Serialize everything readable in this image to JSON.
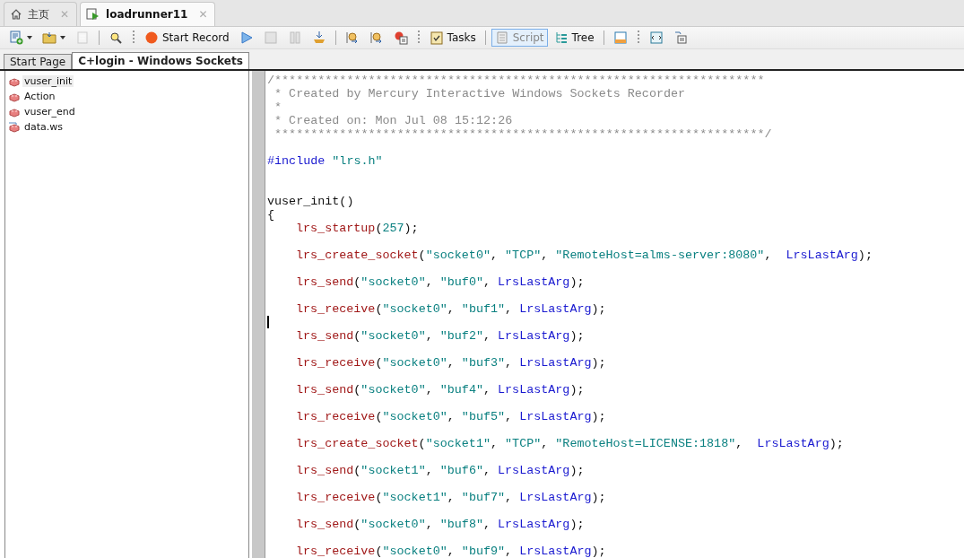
{
  "doc_tabs": [
    {
      "label": "主页",
      "close": "✕",
      "selected": false
    },
    {
      "label": "loadrunner11",
      "close": "✕",
      "selected": true
    }
  ],
  "toolbar": [
    {
      "kind": "new",
      "dropdown": true
    },
    {
      "kind": "open",
      "dropdown": true
    },
    {
      "kind": "save",
      "disabled": true
    },
    {
      "kind": "sep"
    },
    {
      "kind": "find"
    },
    {
      "kind": "grip"
    },
    {
      "kind": "record",
      "label": "Start Record"
    },
    {
      "kind": "play"
    },
    {
      "kind": "stop",
      "disabled": true
    },
    {
      "kind": "pause",
      "disabled": true
    },
    {
      "kind": "compile"
    },
    {
      "kind": "sep"
    },
    {
      "kind": "stepin"
    },
    {
      "kind": "stepout"
    },
    {
      "kind": "breakpoint"
    },
    {
      "kind": "grip"
    },
    {
      "kind": "tasks",
      "label": "Tasks"
    },
    {
      "kind": "sep"
    },
    {
      "kind": "script",
      "label": "Script",
      "selected": true
    },
    {
      "kind": "tree",
      "label": "Tree",
      "selected": false
    },
    {
      "kind": "sep"
    },
    {
      "kind": "layout"
    },
    {
      "kind": "grip"
    },
    {
      "kind": "params"
    },
    {
      "kind": "list"
    }
  ],
  "editor_tabs": [
    {
      "label": "Start Page",
      "selected": false
    },
    {
      "label": "C+login - Windows Sockets",
      "selected": true
    }
  ],
  "tree": [
    {
      "label": "vuser_init",
      "kind": "action",
      "selected": true
    },
    {
      "label": "Action",
      "kind": "action",
      "selected": false
    },
    {
      "label": "vuser_end",
      "kind": "action",
      "selected": false
    },
    {
      "label": "data.ws",
      "kind": "data",
      "selected": false
    }
  ],
  "code": [
    {
      "kind": "text",
      "parts": [
        {
          "kind": "comment",
          "text": "/********************************************************************"
        }
      ]
    },
    {
      "kind": "text",
      "parts": [
        {
          "kind": "comment",
          "text": " * Created by Mercury Interactive Windows Sockets Recorder"
        }
      ]
    },
    {
      "kind": "text",
      "parts": [
        {
          "kind": "comment",
          "text": " *"
        }
      ]
    },
    {
      "kind": "text",
      "parts": [
        {
          "kind": "comment",
          "text": " * Created on: Mon Jul 08 15:12:26"
        }
      ]
    },
    {
      "kind": "text",
      "parts": [
        {
          "kind": "comment",
          "text": " ********************************************************************/"
        }
      ]
    },
    {
      "kind": "blank"
    },
    {
      "kind": "text",
      "parts": [
        {
          "kind": "keyword",
          "text": "#include"
        },
        {
          "kind": "string",
          "text": " \"lrs.h\""
        }
      ]
    },
    {
      "kind": "blank"
    },
    {
      "kind": "blank"
    },
    {
      "kind": "text",
      "parts": [
        {
          "kind": "plain",
          "text": "vuser_init()"
        }
      ]
    },
    {
      "kind": "text",
      "parts": [
        {
          "kind": "plain",
          "text": "{"
        }
      ]
    },
    {
      "kind": "text",
      "indent": true,
      "parts": [
        {
          "kind": "function",
          "text": "lrs_startup"
        },
        {
          "kind": "plain",
          "text": "("
        },
        {
          "kind": "string",
          "text": "257"
        },
        {
          "kind": "plain",
          "text": ");"
        }
      ]
    },
    {
      "kind": "blank"
    },
    {
      "kind": "text",
      "indent": true,
      "parts": [
        {
          "kind": "function",
          "text": "lrs_create_socket"
        },
        {
          "kind": "plain",
          "text": "("
        },
        {
          "kind": "string",
          "text": "\"socket0\""
        },
        {
          "kind": "plain",
          "text": ", "
        },
        {
          "kind": "string",
          "text": "\"TCP\""
        },
        {
          "kind": "plain",
          "text": ", "
        },
        {
          "kind": "string",
          "text": "\"RemoteHost=alms-server:8080\""
        },
        {
          "kind": "plain",
          "text": ",  "
        },
        {
          "kind": "keyword",
          "text": "LrsLastArg"
        },
        {
          "kind": "plain",
          "text": ");"
        }
      ]
    },
    {
      "kind": "blank"
    },
    {
      "kind": "text",
      "indent": true,
      "parts": [
        {
          "kind": "function",
          "text": "lrs_send"
        },
        {
          "kind": "plain",
          "text": "("
        },
        {
          "kind": "string",
          "text": "\"socket0\""
        },
        {
          "kind": "plain",
          "text": ", "
        },
        {
          "kind": "string",
          "text": "\"buf0\""
        },
        {
          "kind": "plain",
          "text": ", "
        },
        {
          "kind": "keyword",
          "text": "LrsLastArg"
        },
        {
          "kind": "plain",
          "text": ");"
        }
      ]
    },
    {
      "kind": "blank"
    },
    {
      "kind": "text",
      "indent": true,
      "parts": [
        {
          "kind": "function",
          "text": "lrs_receive"
        },
        {
          "kind": "plain",
          "text": "("
        },
        {
          "kind": "string",
          "text": "\"socket0\""
        },
        {
          "kind": "plain",
          "text": ", "
        },
        {
          "kind": "string",
          "text": "\"buf1\""
        },
        {
          "kind": "plain",
          "text": ", "
        },
        {
          "kind": "keyword",
          "text": "LrsLastArg"
        },
        {
          "kind": "plain",
          "text": ");"
        }
      ]
    },
    {
      "kind": "blank",
      "caret": true
    },
    {
      "kind": "text",
      "indent": true,
      "parts": [
        {
          "kind": "function",
          "text": "lrs_send"
        },
        {
          "kind": "plain",
          "text": "("
        },
        {
          "kind": "string",
          "text": "\"socket0\""
        },
        {
          "kind": "plain",
          "text": ", "
        },
        {
          "kind": "string",
          "text": "\"buf2\""
        },
        {
          "kind": "plain",
          "text": ", "
        },
        {
          "kind": "keyword",
          "text": "LrsLastArg"
        },
        {
          "kind": "plain",
          "text": ");"
        }
      ]
    },
    {
      "kind": "blank"
    },
    {
      "kind": "text",
      "indent": true,
      "parts": [
        {
          "kind": "function",
          "text": "lrs_receive"
        },
        {
          "kind": "plain",
          "text": "("
        },
        {
          "kind": "string",
          "text": "\"socket0\""
        },
        {
          "kind": "plain",
          "text": ", "
        },
        {
          "kind": "string",
          "text": "\"buf3\""
        },
        {
          "kind": "plain",
          "text": ", "
        },
        {
          "kind": "keyword",
          "text": "LrsLastArg"
        },
        {
          "kind": "plain",
          "text": ");"
        }
      ]
    },
    {
      "kind": "blank"
    },
    {
      "kind": "text",
      "indent": true,
      "parts": [
        {
          "kind": "function",
          "text": "lrs_send"
        },
        {
          "kind": "plain",
          "text": "("
        },
        {
          "kind": "string",
          "text": "\"socket0\""
        },
        {
          "kind": "plain",
          "text": ", "
        },
        {
          "kind": "string",
          "text": "\"buf4\""
        },
        {
          "kind": "plain",
          "text": ", "
        },
        {
          "kind": "keyword",
          "text": "LrsLastArg"
        },
        {
          "kind": "plain",
          "text": ");"
        }
      ]
    },
    {
      "kind": "blank"
    },
    {
      "kind": "text",
      "indent": true,
      "parts": [
        {
          "kind": "function",
          "text": "lrs_receive"
        },
        {
          "kind": "plain",
          "text": "("
        },
        {
          "kind": "string",
          "text": "\"socket0\""
        },
        {
          "kind": "plain",
          "text": ", "
        },
        {
          "kind": "string",
          "text": "\"buf5\""
        },
        {
          "kind": "plain",
          "text": ", "
        },
        {
          "kind": "keyword",
          "text": "LrsLastArg"
        },
        {
          "kind": "plain",
          "text": ");"
        }
      ]
    },
    {
      "kind": "blank"
    },
    {
      "kind": "text",
      "indent": true,
      "parts": [
        {
          "kind": "function",
          "text": "lrs_create_socket"
        },
        {
          "kind": "plain",
          "text": "("
        },
        {
          "kind": "string",
          "text": "\"socket1\""
        },
        {
          "kind": "plain",
          "text": ", "
        },
        {
          "kind": "string",
          "text": "\"TCP\""
        },
        {
          "kind": "plain",
          "text": ", "
        },
        {
          "kind": "string",
          "text": "\"RemoteHost=LICENSE:1818\""
        },
        {
          "kind": "plain",
          "text": ",  "
        },
        {
          "kind": "keyword",
          "text": "LrsLastArg"
        },
        {
          "kind": "plain",
          "text": ");"
        }
      ]
    },
    {
      "kind": "blank"
    },
    {
      "kind": "text",
      "indent": true,
      "parts": [
        {
          "kind": "function",
          "text": "lrs_send"
        },
        {
          "kind": "plain",
          "text": "("
        },
        {
          "kind": "string",
          "text": "\"socket1\""
        },
        {
          "kind": "plain",
          "text": ", "
        },
        {
          "kind": "string",
          "text": "\"buf6\""
        },
        {
          "kind": "plain",
          "text": ", "
        },
        {
          "kind": "keyword",
          "text": "LrsLastArg"
        },
        {
          "kind": "plain",
          "text": ");"
        }
      ]
    },
    {
      "kind": "blank"
    },
    {
      "kind": "text",
      "indent": true,
      "parts": [
        {
          "kind": "function",
          "text": "lrs_receive"
        },
        {
          "kind": "plain",
          "text": "("
        },
        {
          "kind": "string",
          "text": "\"socket1\""
        },
        {
          "kind": "plain",
          "text": ", "
        },
        {
          "kind": "string",
          "text": "\"buf7\""
        },
        {
          "kind": "plain",
          "text": ", "
        },
        {
          "kind": "keyword",
          "text": "LrsLastArg"
        },
        {
          "kind": "plain",
          "text": ");"
        }
      ]
    },
    {
      "kind": "blank"
    },
    {
      "kind": "text",
      "indent": true,
      "parts": [
        {
          "kind": "function",
          "text": "lrs_send"
        },
        {
          "kind": "plain",
          "text": "("
        },
        {
          "kind": "string",
          "text": "\"socket0\""
        },
        {
          "kind": "plain",
          "text": ", "
        },
        {
          "kind": "string",
          "text": "\"buf8\""
        },
        {
          "kind": "plain",
          "text": ", "
        },
        {
          "kind": "keyword",
          "text": "LrsLastArg"
        },
        {
          "kind": "plain",
          "text": ");"
        }
      ]
    },
    {
      "kind": "blank"
    },
    {
      "kind": "text",
      "indent": true,
      "parts": [
        {
          "kind": "function",
          "text": "lrs_receive"
        },
        {
          "kind": "plain",
          "text": "("
        },
        {
          "kind": "string",
          "text": "\"socket0\""
        },
        {
          "kind": "plain",
          "text": ", "
        },
        {
          "kind": "string",
          "text": "\"buf9\""
        },
        {
          "kind": "plain",
          "text": ", "
        },
        {
          "kind": "keyword",
          "text": "LrsLastArg"
        },
        {
          "kind": "plain",
          "text": ");"
        }
      ]
    }
  ]
}
